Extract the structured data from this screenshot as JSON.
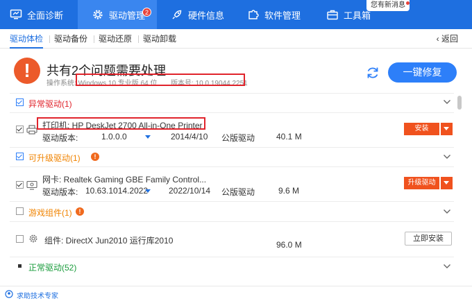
{
  "nav": {
    "tabs": [
      {
        "label": "全面诊断",
        "icon": "monitor-icon"
      },
      {
        "label": "驱动管理",
        "icon": "gear-icon",
        "badge": "2"
      },
      {
        "label": "硬件信息",
        "icon": "rocket-icon"
      },
      {
        "label": "软件管理",
        "icon": "puzzle-icon"
      },
      {
        "label": "工具箱",
        "icon": "toolbox-icon"
      }
    ],
    "toast": "您有新消息"
  },
  "subnav": {
    "tabs": [
      "驱动体检",
      "驱动备份",
      "驱动还原",
      "驱动卸载"
    ],
    "back": "返回"
  },
  "header": {
    "headline": "共有2个问题需要处理",
    "sys_label": "操作系统:",
    "sys_value": "Windows 10 专业版 64 位",
    "ver_label": "版本号:",
    "ver_value": "10.0.19044.2251",
    "fix_button": "一键修复"
  },
  "sections": {
    "abnormal": {
      "title": "异常驱动(1)"
    },
    "upgradable": {
      "title": "可升级驱动(1)"
    },
    "game": {
      "title": "游戏组件(1)"
    },
    "normal": {
      "title": "正常驱动(52)"
    }
  },
  "rows": {
    "printer": {
      "name": "打印机: HP DeskJet 2700 All-in-One Printer",
      "version_label": "驱动版本:",
      "version": "1.0.0.0",
      "date": "2014/4/10",
      "type": "公版驱动",
      "size": "40.1 M",
      "action": "安装"
    },
    "nic": {
      "name": "网卡: Realtek Gaming GBE Family Control...",
      "version_label": "驱动版本:",
      "version": "10.63.1014.2022",
      "date": "2022/10/14",
      "type": "公版驱动",
      "size": "9.6 M",
      "action": "升级驱动"
    },
    "directx": {
      "name": "组件: DirectX Jun2010 运行库2010",
      "size": "96.0 M",
      "action": "立即安装"
    }
  },
  "footer": {
    "link": "求助技术专家"
  },
  "colors": {
    "brand": "#1e6fe0",
    "warn": "#ec5a2a",
    "abnormal": "#e0232b",
    "upgrade": "#f08300",
    "normal": "#1a9c3c",
    "action": "#f0521e"
  }
}
